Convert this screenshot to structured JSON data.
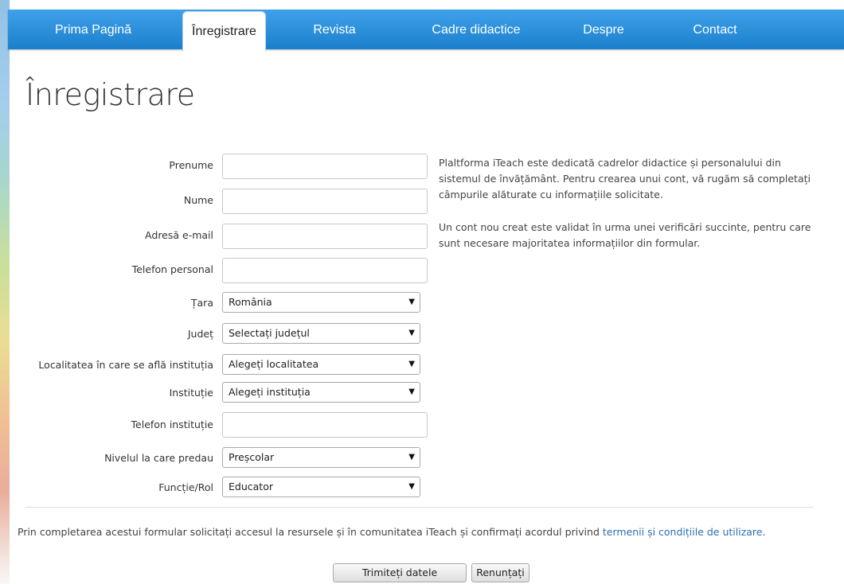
{
  "nav": {
    "items": [
      {
        "label": "Prima Pagină"
      },
      {
        "label": "Înregistrare"
      },
      {
        "label": "Revista"
      },
      {
        "label": "Cadre didactice"
      },
      {
        "label": "Despre"
      },
      {
        "label": "Contact"
      }
    ],
    "active_index": 1
  },
  "page": {
    "title": "Înregistrare"
  },
  "form": {
    "prenume": {
      "label": "Prenume",
      "value": ""
    },
    "nume": {
      "label": "Nume",
      "value": ""
    },
    "email": {
      "label": "Adresă e-mail",
      "value": ""
    },
    "telefon_personal": {
      "label": "Telefon personal",
      "value": ""
    },
    "tara": {
      "label": "Țara",
      "selected": "România"
    },
    "judet": {
      "label": "Județ",
      "selected": "Selectați județul"
    },
    "localitate": {
      "label": "Localitatea în care se află instituția",
      "selected": "Alegeți localitatea"
    },
    "institutie": {
      "label": "Instituție",
      "selected": "Alegeți instituția"
    },
    "telefon_institutie": {
      "label": "Telefon instituție",
      "value": ""
    },
    "nivel": {
      "label": "Nivelul la care predau",
      "selected": "Preșcolar"
    },
    "functie": {
      "label": "Funcție/Rol",
      "selected": "Educator"
    },
    "dropdown_arrow": "▼"
  },
  "info": {
    "paragraph1": "Plaltforma iTeach este dedicată cadrelor didactice și personalului din sistemul de învățământ. Pentru crearea unui cont, vă rugăm să completați câmpurile alăturate cu informațiile solicitate.",
    "paragraph2": "Un cont nou creat este validat în urma unei verificări succinte, pentru care sunt necesare majoritatea informațiilor din formular."
  },
  "terms": {
    "text": "Prin completarea acestui formular solicitați accesul la resursele și în comunitatea iTeach și confirmați acordul privind ",
    "link_label": "termenii și condițiile de utilizare",
    "suffix": "."
  },
  "buttons": {
    "submit_label": "Trimiteți datele",
    "cancel_label": "Renunțați"
  },
  "colors": {
    "nav_top": "#3fa1ea",
    "nav_bottom": "#1b7fcc",
    "link": "#2c6fb2"
  }
}
